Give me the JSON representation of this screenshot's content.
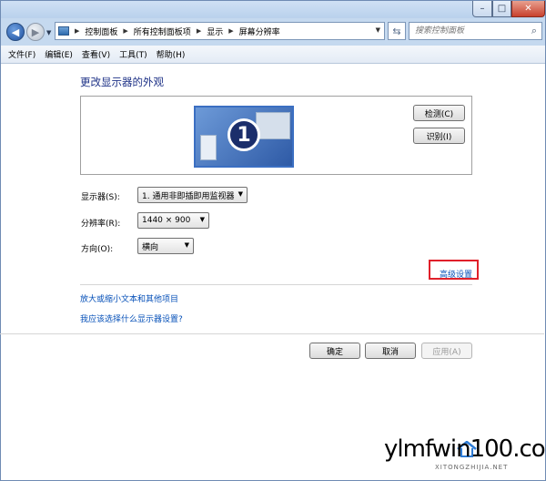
{
  "window": {
    "minimize_glyph": "–",
    "maximize_glyph": "□",
    "close_glyph": "✕"
  },
  "address_bar": {
    "breadcrumbs": [
      "控制面板",
      "所有控制面板项",
      "显示",
      "屏幕分辨率"
    ],
    "search_placeholder": "搜索控制面板"
  },
  "menu": [
    "文件(F)",
    "编辑(E)",
    "查看(V)",
    "工具(T)",
    "帮助(H)"
  ],
  "page": {
    "title": "更改显示器的外观",
    "monitor_number": "1",
    "detect_button": "检测(C)",
    "identify_button": "识别(I)",
    "display_label": "显示器(S):",
    "display_value": "1. 通用非即插即用监视器",
    "resolution_label": "分辨率(R):",
    "resolution_value": "1440 × 900",
    "orientation_label": "方向(O):",
    "orientation_value": "横向",
    "advanced_link": "高级设置",
    "link_text_size": "放大或缩小文本和其他项目",
    "link_which_settings": "我应该选择什么显示器设置?",
    "ok_button": "确定",
    "cancel_button": "取消",
    "apply_button": "应用(A)"
  },
  "watermark": {
    "text": "ylmfwin100.com",
    "subtext": "XITONGZHIJIA.NET"
  },
  "colors": {
    "link": "#0650b8",
    "title": "#1e3287",
    "highlight_box": "#e0202a"
  }
}
